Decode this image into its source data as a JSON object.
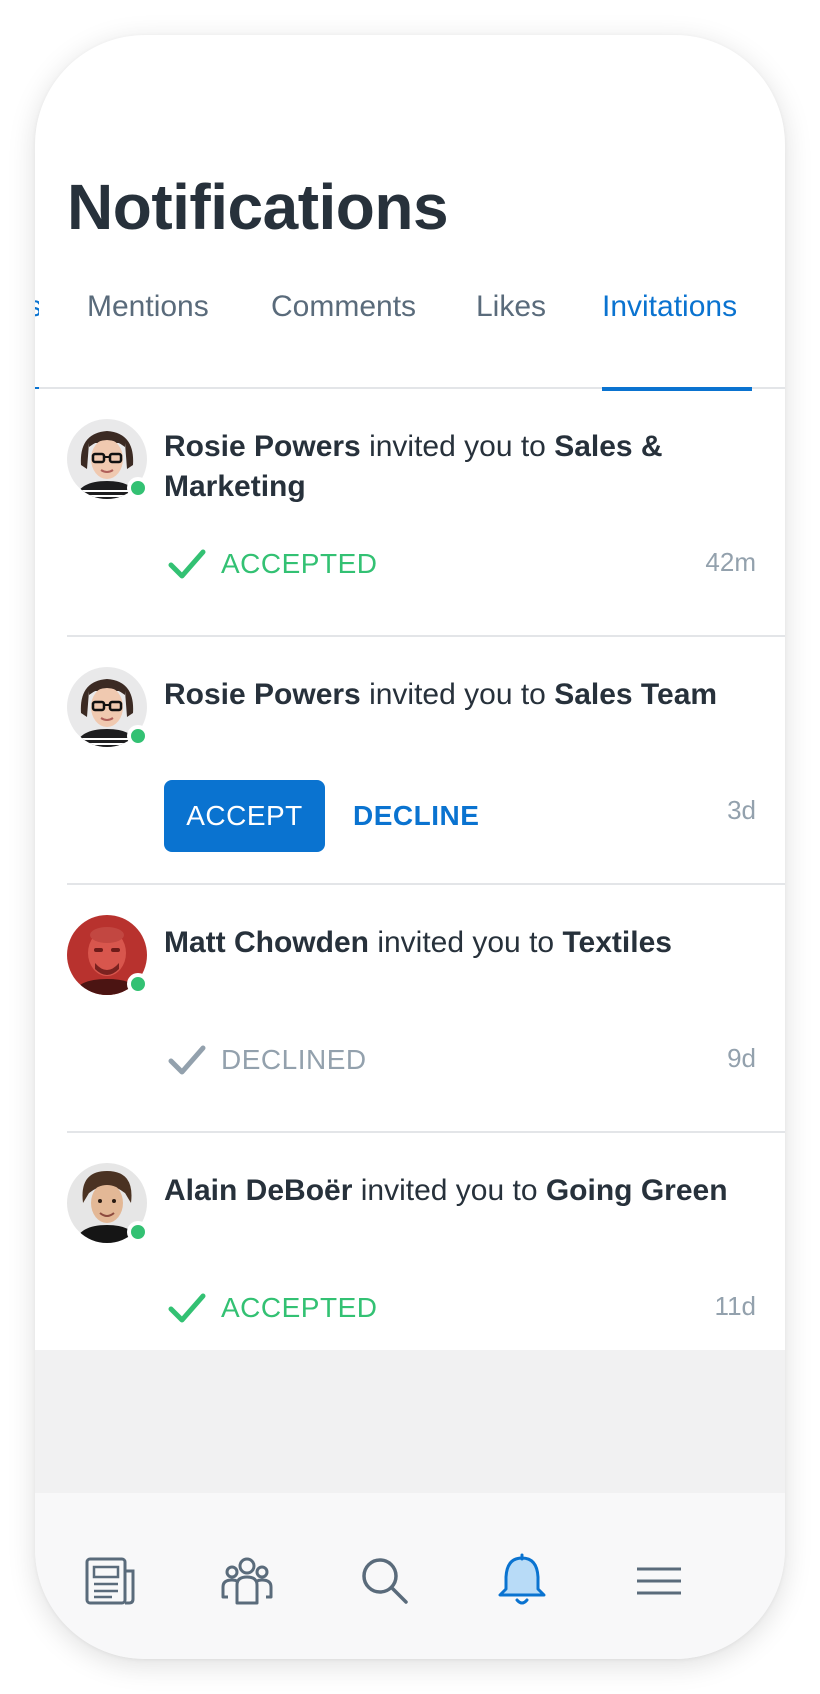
{
  "page": {
    "title": "Notifications"
  },
  "tabs": [
    {
      "label": "s",
      "active": false
    },
    {
      "label": "Mentions",
      "active": false
    },
    {
      "label": "Comments",
      "active": false
    },
    {
      "label": "Likes",
      "active": false
    },
    {
      "label": "Invitations",
      "active": true
    }
  ],
  "notifications": [
    {
      "user": "Rosie Powers",
      "action": " invited you to ",
      "target": "Sales & Marketing",
      "status": "ACCEPTED",
      "time": "42m",
      "online": true,
      "avatar_icon": "woman-glasses-avatar"
    },
    {
      "user": "Rosie Powers",
      "action": " invited you to ",
      "target": "Sales Team",
      "accept_label": "ACCEPT",
      "decline_label": "DECLINE",
      "time": "3d",
      "online": true,
      "avatar_icon": "woman-glasses-avatar"
    },
    {
      "user": "Matt Chowden",
      "action": " invited you to ",
      "target": "Textiles",
      "status": "DECLINED",
      "time": "9d",
      "online": true,
      "avatar_icon": "man-red-avatar"
    },
    {
      "user": "Alain DeBoër",
      "action": " invited you to ",
      "target": "Going Green",
      "status": "ACCEPTED",
      "time": "11d",
      "online": true,
      "avatar_icon": "man-curly-hair-avatar"
    }
  ],
  "bottom_nav": [
    {
      "icon": "newspaper-icon",
      "active": false
    },
    {
      "icon": "people-icon",
      "active": false
    },
    {
      "icon": "search-icon",
      "active": false
    },
    {
      "icon": "bell-icon",
      "active": true
    },
    {
      "icon": "menu-icon",
      "active": false
    }
  ],
  "colors": {
    "accent": "#0a73d0",
    "accepted": "#33c173",
    "declined": "#93a1ad",
    "online": "#33c173",
    "text": "#27313b"
  }
}
